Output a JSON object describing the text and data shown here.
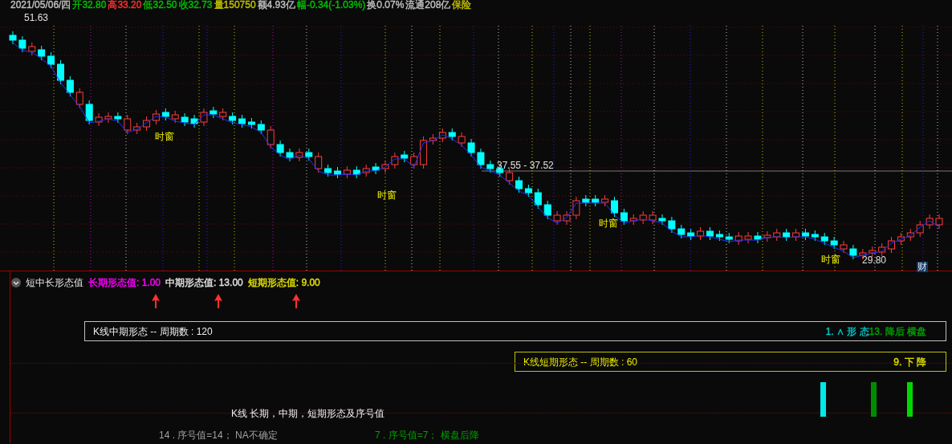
{
  "quote_bar": [
    {
      "text": "2021/05/06/四",
      "color": "#c0c0c0"
    },
    {
      "text": "开32.80",
      "color": "#00c000"
    },
    {
      "text": "高33.20",
      "color": "#ff3232"
    },
    {
      "text": "低32.50",
      "color": "#00c000"
    },
    {
      "text": "收32.73",
      "color": "#00c000"
    },
    {
      "text": "量150750",
      "color": "#c0c000"
    },
    {
      "text": "额4.93亿",
      "color": "#c0c0c0"
    },
    {
      "text": "幅-0.34(-1.03%)",
      "color": "#00c000"
    },
    {
      "text": "换0.07%",
      "color": "#c0c0c0"
    },
    {
      "text": "流通208亿",
      "color": "#c0c0c0"
    },
    {
      "text": "保险",
      "color": "#c0c000"
    }
  ],
  "chart_labels": {
    "high": "51.63",
    "range": "37.55 - 37.52",
    "low": "29.80",
    "time_windows": [
      "时窗",
      "时窗",
      "时窗",
      "时窗"
    ],
    "finance_mark": "财"
  },
  "indicator": {
    "title": "短中长形态值",
    "values": [
      {
        "text": "长期形态值: 1.00",
        "color": "#ff00ff"
      },
      {
        "text": "中期形态值: 13.00",
        "color": "#e0e0e0"
      },
      {
        "text": "短期形态值: 9.00",
        "color": "#e0e000"
      }
    ]
  },
  "medium_box": {
    "title": "K线中期形态 -- 周期数 : 120",
    "results": [
      {
        "text": "1. ∧ 形 态",
        "color": "#00c8c8"
      },
      {
        "text": "13. 降后 横盘",
        "color": "#00a000"
      }
    ]
  },
  "short_box": {
    "title": "K线短期形态 -- 周期数 : 60",
    "results": [
      {
        "text": "9. 下 降",
        "color": "#e0e000"
      }
    ]
  },
  "bars": [
    {
      "color": "#00e8e8"
    },
    {
      "color": "#008c00"
    },
    {
      "color": "#00d800"
    }
  ],
  "caption": "K线 长期，中期，短期形态及序号值",
  "notes": [
    {
      "text": "14 . 序号值=14； NA不确定",
      "color": "#a0a0a0"
    },
    {
      "text": "7 . 序号值=7； 横盘后降",
      "color": "#00a000"
    }
  ]
}
